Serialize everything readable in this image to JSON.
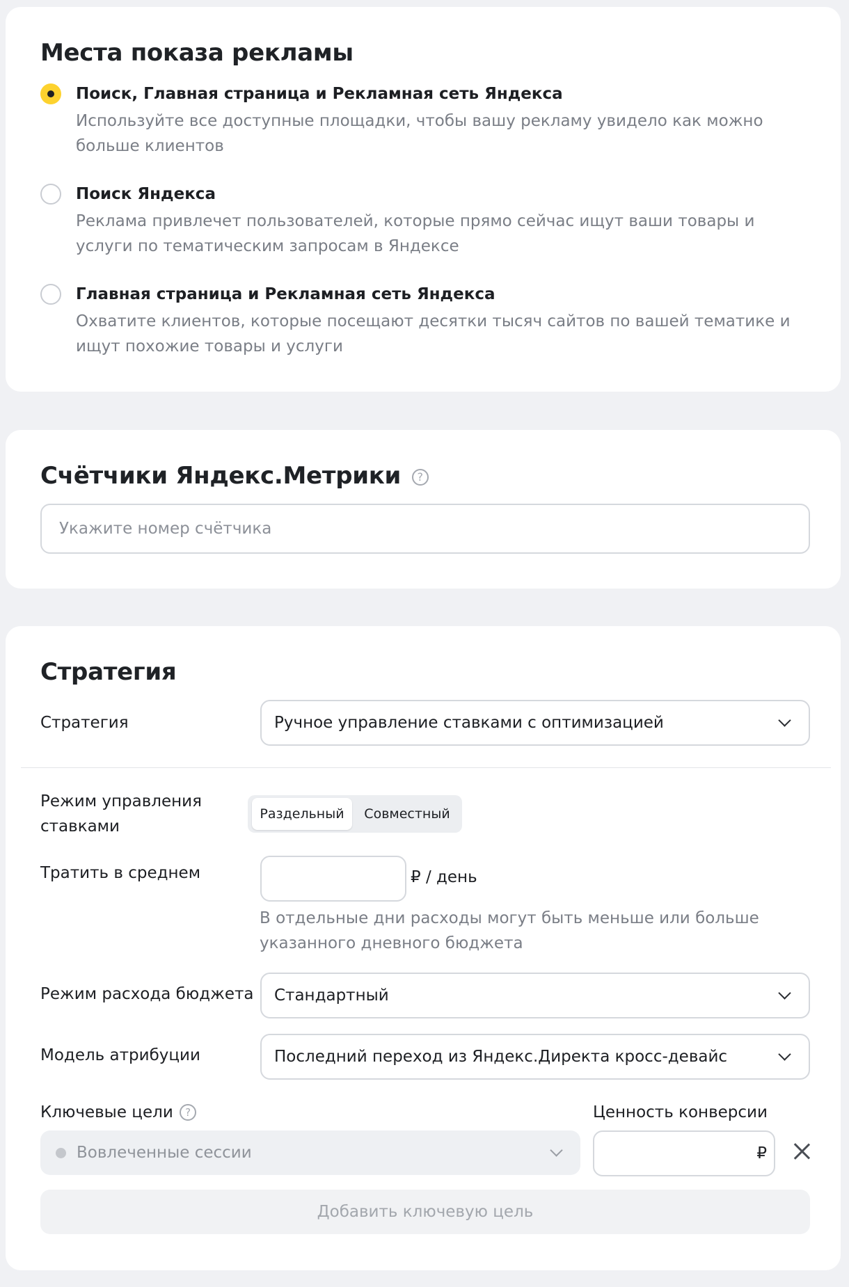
{
  "placements": {
    "title": "Места показа рекламы",
    "options": [
      {
        "title": "Поиск, Главная страница и Рекламная сеть Яндекса",
        "description": "Используйте все доступные площадки, чтобы вашу рекламу увидело как можно больше клиентов",
        "selected": true
      },
      {
        "title": "Поиск Яндекса",
        "description": "Реклама привлечет пользователей, которые прямо сейчас ищут ваши товары и услуги по тематическим запросам в Яндексе",
        "selected": false
      },
      {
        "title": "Главная страница и Рекламная сеть Яндекса",
        "description": "Охватите клиентов, которые посещают десятки тысяч сайтов по вашей тематике и ищут похожие товары и услуги",
        "selected": false
      }
    ]
  },
  "metrika": {
    "title": "Счётчики Яндекс.Метрики",
    "help_glyph": "?",
    "input_placeholder": "Укажите номер счётчика"
  },
  "strategy": {
    "title": "Стратегия",
    "strategy_label": "Стратегия",
    "strategy_value": "Ручное управление ставками с оптимизацией",
    "bid_mode_label": "Режим управления ставками",
    "bid_modes": [
      "Раздельный",
      "Совместный"
    ],
    "bid_mode_selected": "Раздельный",
    "spend_label": "Тратить в среднем",
    "spend_value": "",
    "spend_suffix": "₽ / день",
    "spend_hint": "В отдельные дни расходы могут быть меньше или больше указанного дневного бюджета",
    "budget_mode_label": "Режим расхода бюджета",
    "budget_mode_value": "Стандартный",
    "attribution_label": "Модель атрибуции",
    "attribution_value": "Последний переход из Яндекс.Директа кросс-девайс",
    "key_goals_label": "Ключевые цели",
    "key_goals_help_glyph": "?",
    "conversion_value_label": "Ценность конверсии",
    "goal_value": "Вовлеченные сессии",
    "conversion_value": "",
    "currency": "₽",
    "add_goal_label": "Добавить ключевую цель"
  }
}
